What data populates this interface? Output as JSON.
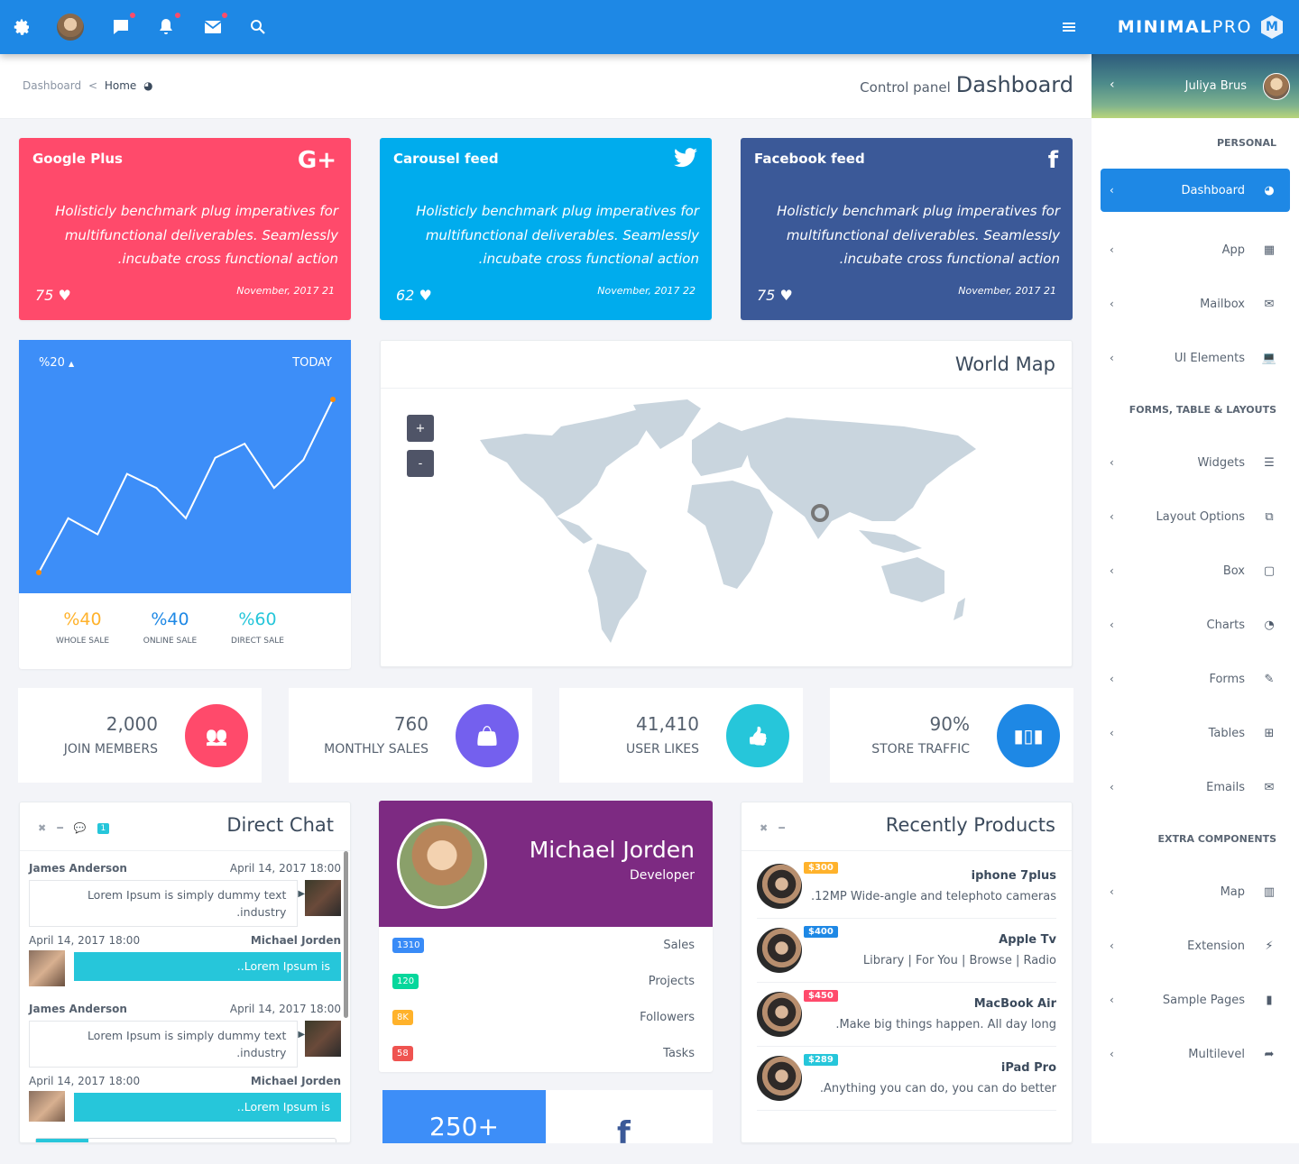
{
  "topbar": {
    "icons": [
      "gear-icon",
      "avatar",
      "chat-icon",
      "bell-icon",
      "mail-icon",
      "search-icon"
    ],
    "menu_icon": "hamburger-icon"
  },
  "brand": {
    "bold": "MINIMAL",
    "light": "PRO",
    "mark": "M"
  },
  "breadcrumb": {
    "root": "Dashboard",
    "sep": "<",
    "current": "Home"
  },
  "page": {
    "subtitle": "Control panel",
    "title": "Dashboard"
  },
  "user": {
    "name": "Juliya Brus"
  },
  "sidebar": {
    "sections": [
      {
        "header": "PERSONAL",
        "items": [
          {
            "label": "Dashboard",
            "icon": "dashboard-icon",
            "active": true
          },
          {
            "label": "App",
            "icon": "grid-icon"
          },
          {
            "label": "Mailbox",
            "icon": "envelope-icon"
          },
          {
            "label": "UI Elements",
            "icon": "laptop-icon"
          }
        ]
      },
      {
        "header": "FORMS, TABLE & LAYOUTS",
        "items": [
          {
            "label": "Widgets",
            "icon": "bars-icon"
          },
          {
            "label": "Layout Options",
            "icon": "copy-icon"
          },
          {
            "label": "Box",
            "icon": "square-icon"
          },
          {
            "label": "Charts",
            "icon": "pie-chart-icon"
          },
          {
            "label": "Forms",
            "icon": "edit-icon"
          },
          {
            "label": "Tables",
            "icon": "table-icon"
          },
          {
            "label": "Emails",
            "icon": "envelope-open-icon"
          }
        ]
      },
      {
        "header": "EXTRA COMPONENTS",
        "items": [
          {
            "label": "Map",
            "icon": "map-icon"
          },
          {
            "label": "Extension",
            "icon": "plug-icon"
          },
          {
            "label": "Sample Pages",
            "icon": "file-icon"
          },
          {
            "label": "Multilevel",
            "icon": "share-icon"
          }
        ]
      }
    ]
  },
  "feeds": [
    {
      "title": "Google Plus",
      "icon": "G+",
      "color": "#ff4a6b",
      "body": "Holisticly benchmark plug imperatives for multifunctional deliverables. Seamlessly .incubate cross functional action",
      "likes": "75",
      "date": "November, 2017 21"
    },
    {
      "title": "Carousel feed",
      "icon": "twitter",
      "color": "#00aced",
      "body": "Holisticly benchmark plug imperatives for multifunctional deliverables. Seamlessly .incubate cross functional action",
      "likes": "62",
      "date": "November, 2017 22"
    },
    {
      "title": "Facebook feed",
      "icon": "f",
      "color": "#3b5998",
      "body": "Holisticly benchmark plug imperatives for multifunctional deliverables. Seamlessly .incubate cross functional action",
      "likes": "75",
      "date": "November, 2017 21"
    }
  ],
  "sales_chart": {
    "change": "%20",
    "period": "TODAY",
    "values": [
      0,
      27,
      19,
      49,
      42,
      27,
      57,
      64,
      42,
      56,
      86
    ],
    "stats": [
      {
        "value": "%40",
        "label": "WHOLE SALE",
        "color": "#ffb22b"
      },
      {
        "value": "%40",
        "label": "ONLINE SALE",
        "color": "#1e88e5"
      },
      {
        "value": "%60",
        "label": "DIRECT SALE",
        "color": "#26c6da"
      }
    ]
  },
  "world_map": {
    "title": "World Map",
    "zoom_in": "+",
    "zoom_out": "-",
    "marker": "India"
  },
  "stats": [
    {
      "value": "2,000",
      "label": "JOIN MEMBERS",
      "icon": "users-icon",
      "color": "#ff4a6b"
    },
    {
      "value": "760",
      "label": "MONTHLY SALES",
      "icon": "shopping-bag-icon",
      "color": "#7460ee"
    },
    {
      "value": "41,410",
      "label": "USER LIKES",
      "icon": "thumbs-up-icon",
      "color": "#26c6da"
    },
    {
      "value": "90%",
      "label": "STORE TRAFFIC",
      "icon": "bar-chart-icon",
      "color": "#1e88e5"
    }
  ],
  "chat": {
    "title": "Direct Chat",
    "badge": "1",
    "messages": [
      {
        "name": "James Anderson",
        "time": "April 14, 2017 18:00",
        "text": "Lorem Ipsum is simply dummy text .industry",
        "side": "left"
      },
      {
        "name": "Michael Jorden",
        "time": "April 14, 2017 18:00",
        "text": "..Lorem Ipsum is",
        "side": "right"
      },
      {
        "name": "James Anderson",
        "time": "April 14, 2017 18:00",
        "text": "Lorem Ipsum is simply dummy text .industry",
        "side": "left"
      },
      {
        "name": "Michael Jorden",
        "time": "April 14, 2017 18:00",
        "text": "..Lorem Ipsum is",
        "side": "right"
      }
    ]
  },
  "profile": {
    "name": "Michael Jorden",
    "role": "Developer",
    "rows": [
      {
        "badge": "1310",
        "label": "Sales",
        "color": "#398bf7"
      },
      {
        "badge": "120",
        "label": "Projects",
        "color": "#06d79c"
      },
      {
        "badge": "8K",
        "label": "Followers",
        "color": "#ffb22b"
      },
      {
        "badge": "58",
        "label": "Tasks",
        "color": "#ef5350"
      }
    ]
  },
  "social_counter": {
    "value": "250+",
    "icon": "facebook-icon"
  },
  "products": {
    "title": "Recently Products",
    "items": [
      {
        "name": "iphone 7plus",
        "desc": ".12MP Wide-angle and telephoto cameras",
        "price": "$300",
        "color": "#ffb22b"
      },
      {
        "name": "Apple Tv",
        "desc": "Library | For You | Browse | Radio",
        "price": "$400",
        "color": "#1e88e5"
      },
      {
        "name": "MacBook Air",
        "desc": ".Make big things happen. All day long",
        "price": "$450",
        "color": "#ff4a6b"
      },
      {
        "name": "iPad Pro",
        "desc": ".Anything you can do, you can do better",
        "price": "$289",
        "color": "#26c6da"
      }
    ]
  }
}
